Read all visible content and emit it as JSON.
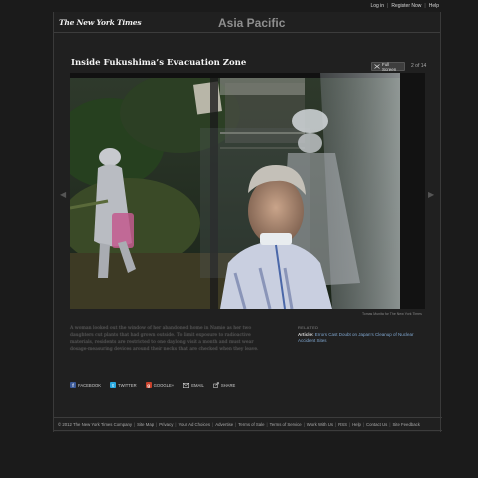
{
  "top_links": {
    "login": "Log in",
    "register": "Register Now",
    "help": "Help"
  },
  "masthead": {
    "logo": "The New York Times",
    "section": "Asia Pacific"
  },
  "slideshow": {
    "headline": "Inside Fukushima’s Evacuation Zone",
    "full_screen": "Full Screen",
    "counter": "2 of 14",
    "photo_credit": "Tomas Munita for The New York Times",
    "caption": "A woman looked out the window of her abandoned home in Namie as her two daughters cut plants that had grown outside. To limit exposure to radioactive materials, residents are restricted to one daylong visit a month and must wear dosage-measuring devices around their necks that are checked when they leave."
  },
  "related": {
    "label": "RELATED",
    "article_type": "Article:",
    "article_title": "Errors Cast Doubt on Japan’s Cleanup of Nuclear Accident Sites"
  },
  "share": {
    "facebook": "FACEBOOK",
    "twitter": "TWITTER",
    "google": "GOOGLE+",
    "email": "EMAIL",
    "share": "SHARE"
  },
  "footer": {
    "links": [
      "© 2012 The New York Times Company",
      "Site Map",
      "Privacy",
      "Your Ad Choices",
      "Advertise",
      "Terms of Sale",
      "Terms of Service",
      "Work With Us",
      "RSS",
      "Help",
      "Contact Us",
      "Site Feedback"
    ]
  },
  "colors": {
    "page_bg": "#1b1b1b",
    "link": "#7fa6cf",
    "facebook": "#3b5998",
    "twitter": "#2aa9e0",
    "google": "#c8412b"
  }
}
